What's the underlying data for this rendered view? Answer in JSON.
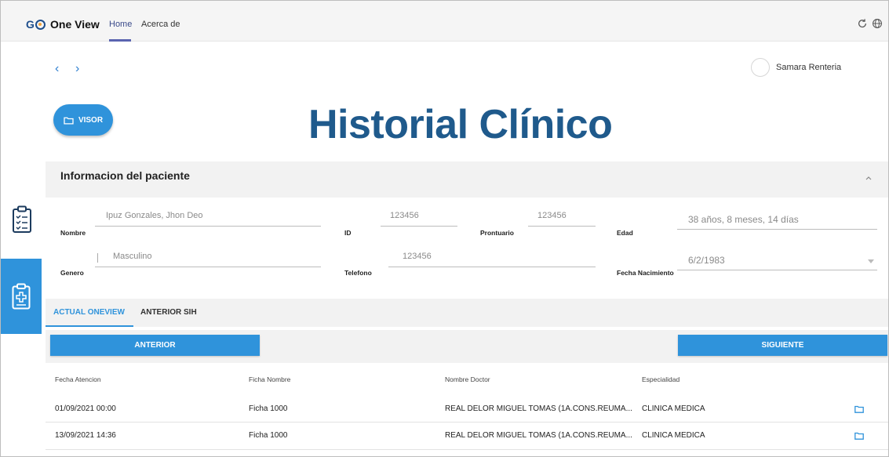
{
  "header": {
    "logo_text": "GO",
    "app_name": "One View",
    "nav": [
      {
        "label": "Home"
      },
      {
        "label": "Acerca de"
      }
    ]
  },
  "user": {
    "name": "Samara Renteria"
  },
  "toolbar": {
    "visor_label": "VISOR"
  },
  "page_title": "Historial Clínico",
  "patient": {
    "section_title": "Informacion del paciente",
    "fields": {
      "nombre": {
        "label": "Nombre",
        "value": "Ipuz Gonzales, Jhon Deo"
      },
      "id": {
        "label": "ID",
        "value": "123456"
      },
      "prontuario": {
        "label": "Prontuario",
        "value": "123456"
      },
      "edad": {
        "label": "Edad",
        "value": "38 años, 8 meses, 14 días"
      },
      "genero": {
        "label": "Genero",
        "value": "Masculino"
      },
      "telefono": {
        "label": "Telefono",
        "value": "123456"
      },
      "fecha_nacimiento": {
        "label": "Fecha Nacimiento",
        "value": "6/2/1983"
      }
    }
  },
  "tabs": [
    {
      "label": "ACTUAL ONEVIEW",
      "active": true
    },
    {
      "label": "ANTERIOR SIH",
      "active": false
    }
  ],
  "pager": {
    "prev_label": "ANTERIOR",
    "next_label": "SIGUIENTE"
  },
  "table": {
    "columns": [
      "Fecha Atencion",
      "Ficha Nombre",
      "Nombre Doctor",
      "Especialidad"
    ],
    "rows": [
      {
        "fecha": "01/09/2021 00:00",
        "ficha": "Ficha 1000",
        "doctor": "REAL DELOR MIGUEL TOMAS (1A.CONS.REUMA...",
        "especialidad": "CLINICA MEDICA"
      },
      {
        "fecha": "13/09/2021 14:36",
        "ficha": "Ficha 1000",
        "doctor": "REAL DELOR MIGUEL TOMAS (1A.CONS.REUMA...",
        "especialidad": "CLINICA MEDICA"
      }
    ]
  },
  "colors": {
    "accent": "#2f93db",
    "title": "#1f5a8c"
  }
}
